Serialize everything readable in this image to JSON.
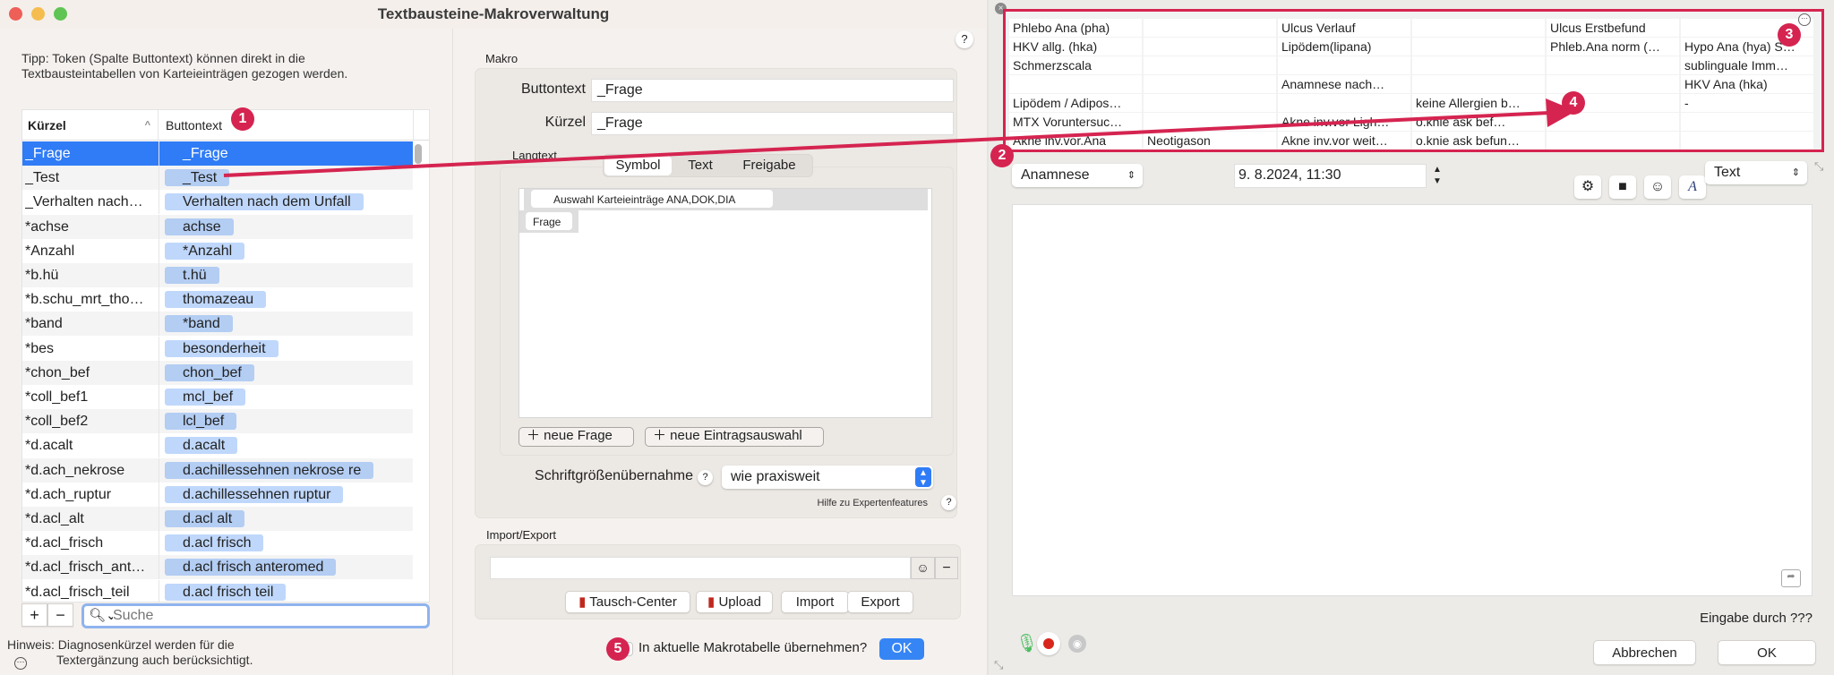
{
  "window_title": "Textbausteine-Makroverwaltung",
  "tip": [
    "Tipp: Token (Spalte Buttontext) können direkt in die",
    "Textbausteintabellen von Karteieinträgen gezogen werden."
  ],
  "table": {
    "col_kuerzel": "Kürzel",
    "col_buttontext": "Buttontext",
    "rows": [
      {
        "k": "_Frage",
        "b": "_Frage"
      },
      {
        "k": "_Test",
        "b": "_Test"
      },
      {
        "k": "_Verhalten nach…",
        "b": "Verhalten nach dem Unfall"
      },
      {
        "k": "*achse",
        "b": "achse"
      },
      {
        "k": "*Anzahl",
        "b": "*Anzahl"
      },
      {
        "k": "*b.hü",
        "b": "t.hü"
      },
      {
        "k": "*b.schu_mrt_tho…",
        "b": "thomazeau"
      },
      {
        "k": "*band",
        "b": "*band"
      },
      {
        "k": "*bes",
        "b": "besonderheit"
      },
      {
        "k": "*chon_bef",
        "b": "chon_bef"
      },
      {
        "k": "*coll_bef1",
        "b": "mcl_bef"
      },
      {
        "k": "*coll_bef2",
        "b": "lcl_bef"
      },
      {
        "k": "*d.acalt",
        "b": "d.acalt"
      },
      {
        "k": "*d.ach_nekrose",
        "b": "d.achillessehnen nekrose re"
      },
      {
        "k": "*d.ach_ruptur",
        "b": "d.achillessehnen ruptur"
      },
      {
        "k": "*d.acl_alt",
        "b": "d.acl alt"
      },
      {
        "k": "*d.acl_frisch",
        "b": "d.acl frisch"
      },
      {
        "k": "*d.acl_frisch_ant…",
        "b": "d.acl frisch anteromed"
      },
      {
        "k": "*d.acl_frisch_teil",
        "b": "d.acl frisch teil"
      }
    ],
    "selected_index": 0
  },
  "search": {
    "placeholder": "Suche",
    "add": "+",
    "remove": "−"
  },
  "hint": [
    "Hinweis: Diagnosenkürzel werden für die",
    "Textergänzung auch berücksichtigt."
  ],
  "makro": {
    "label": "Makro",
    "buttontext_label": "Buttontext",
    "buttontext_value": "_Frage",
    "kuerzel_label": "Kürzel",
    "kuerzel_value": "_Frage",
    "langtext_label": "Langtext",
    "tabs": [
      "Symbol",
      "Text",
      "Freigabe"
    ],
    "active_tab": "Symbol",
    "tokens": {
      "auswahl": "Auswahl Karteieinträge ANA,DOK,DIA",
      "frage": "Frage"
    },
    "neue_frage": "neue Frage",
    "neue_eintrag": "neue Eintragsauswahl",
    "schrift_label": "Schriftgrößenübernahme",
    "schrift_value": "wie praxisweit",
    "hilfe": "Hilfe zu Expertenfeatures",
    "help": "?"
  },
  "import_export": {
    "label": "Import/Export",
    "path_value": "",
    "tausch": "Tausch-Center",
    "upload": "Upload",
    "import": "Import",
    "export": "Export"
  },
  "footer": {
    "checkbox_label": "In aktuelle Makrotabelle übernehmen?",
    "checked": false,
    "ok": "OK"
  },
  "markers": [
    "1",
    "2",
    "3",
    "4",
    "5"
  ],
  "accent": "#d52450",
  "right": {
    "grid": [
      [
        "Phlebo Ana (pha)",
        "",
        "Ulcus Verlauf",
        "",
        "Ulcus Erstbefund",
        ""
      ],
      [
        "HKV allg. (hka)",
        "",
        "Lipödem(lipana)",
        "",
        "Phleb.Ana norm (…",
        "Hypo Ana (hya) S…"
      ],
      [
        "Schmerzscala",
        "",
        "",
        "",
        "",
        "sublinguale Imm…"
      ],
      [
        "",
        "",
        "Anamnese nach…",
        "",
        "",
        "HKV Ana (hka)"
      ],
      [
        "Lipödem / Adipos…",
        "",
        "",
        "keine Allergien b…",
        "",
        "-"
      ],
      [
        "MTX Voruntersuc…",
        "",
        "Akne inv.vor Ligh…",
        "o.knie ask bef…",
        "",
        ""
      ],
      [
        "Akne inv.vor.Ana",
        "Neotigason",
        "Akne inv.vor weit…",
        "o.knie ask befun…",
        "",
        ""
      ]
    ],
    "type_select": "Anamnese",
    "date": "9.  8.2024, 11:30",
    "format_select": "Text",
    "text_value": "",
    "eingabe": "Eingabe durch ???",
    "cancel": "Abbrechen",
    "ok": "OK"
  }
}
